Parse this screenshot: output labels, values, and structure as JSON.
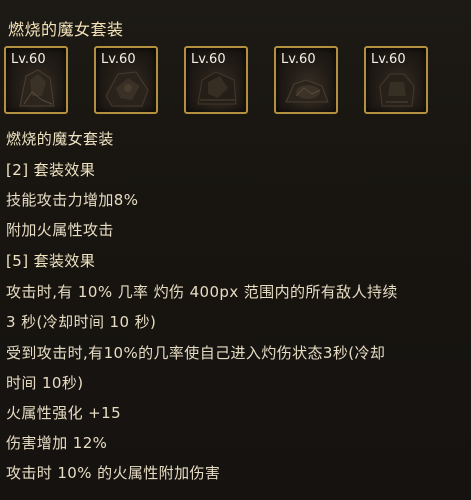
{
  "tooltip": {
    "title": "燃烧的魔女套装",
    "items": [
      {
        "level": "Lv.60",
        "icon": "armor-piece-icon"
      },
      {
        "level": "Lv.60",
        "icon": "armor-piece-icon"
      },
      {
        "level": "Lv.60",
        "icon": "armor-piece-icon"
      },
      {
        "level": "Lv.60",
        "icon": "armor-piece-icon"
      },
      {
        "level": "Lv.60",
        "icon": "armor-piece-icon"
      }
    ],
    "set_name": "燃烧的魔女套装",
    "set2": {
      "header": "[2] 套装效果",
      "effects": [
        "技能攻击力增加8%",
        "附加火属性攻击"
      ]
    },
    "set5": {
      "header": "[5] 套装效果",
      "effects": [
        "攻击时,有 10% 几率 灼伤 400px 范围内的所有敌人持续",
        "3 秒(冷却时间 10 秒)",
        "受到攻击时,有10%的几率使自己进入灼伤状态3秒(冷却",
        "时间 10秒)",
        "火属性强化 +15",
        "伤害增加 12%",
        "攻击时 10% 的火属性附加伤害"
      ]
    }
  }
}
